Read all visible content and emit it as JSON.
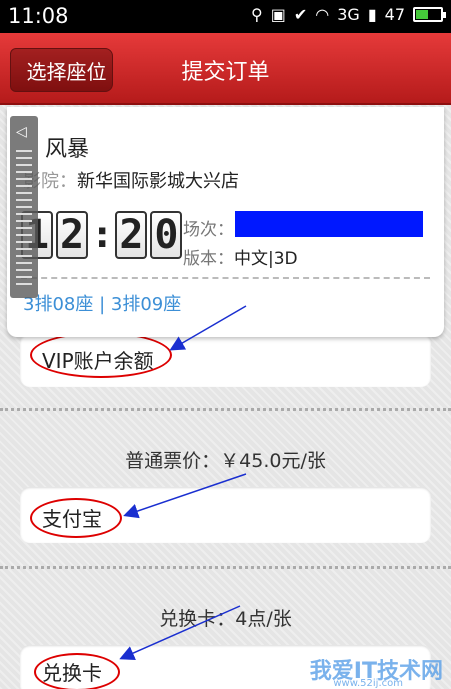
{
  "status_bar": {
    "time": "11:08",
    "network_label": "3G",
    "battery_level": "47",
    "battery_fraction": 0.47
  },
  "header": {
    "back_label": "选择座位",
    "title": "提交订单"
  },
  "movie": {
    "title": "风暴",
    "cinema_label": "影院：",
    "cinema_name": "新华国际影城大兴店",
    "countdown": {
      "minutes": [
        "1",
        "2"
      ],
      "seconds": [
        "2",
        "0"
      ]
    },
    "session_label": "场次：",
    "version_label": "版本：",
    "version_value": "中文|3D",
    "seats": "3排08座 | 3排09座"
  },
  "payments": {
    "vip_label": "VIP账户余额",
    "regular_price": "普通票价：￥45.0元/张",
    "alipay_label": "支付宝",
    "exchange_price": "兑换卡：4点/张",
    "exchange_label": "兑换卡"
  },
  "watermark": {
    "text": "我爱IT技术网",
    "url": "www.52ij.com"
  },
  "colors": {
    "header_red": "#d32f2f",
    "seat_blue": "#3c8fd6",
    "redaction_blue": "#0018ff",
    "annotation_red": "#dd0000",
    "annotation_arrow": "#1a2fd0"
  }
}
